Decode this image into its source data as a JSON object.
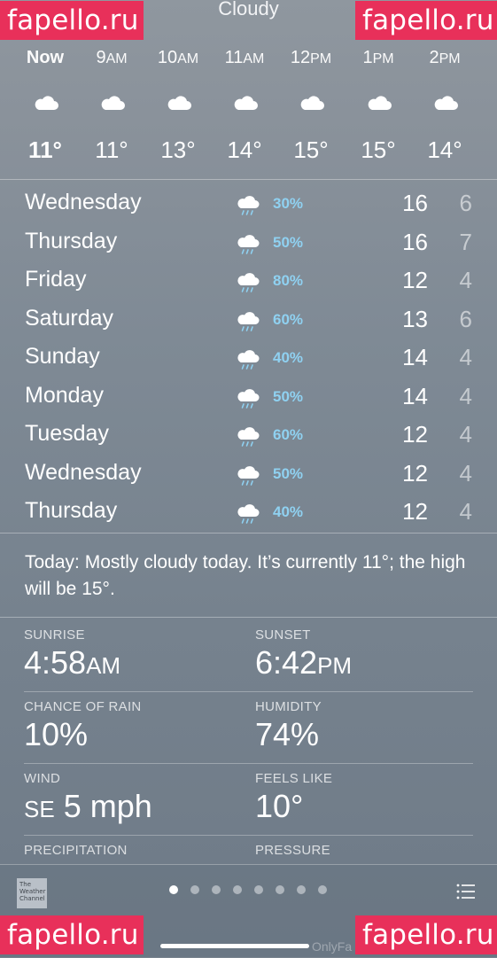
{
  "watermark": "fapello.ru",
  "header": {
    "condition": "Cloudy"
  },
  "hourly": [
    {
      "time": "Now",
      "suffix": "",
      "temp": "11°",
      "icon": "cloud-icon",
      "now": true
    },
    {
      "time": "9",
      "suffix": "AM",
      "temp": "11°",
      "icon": "cloud-icon"
    },
    {
      "time": "10",
      "suffix": "AM",
      "temp": "13°",
      "icon": "cloud-icon"
    },
    {
      "time": "11",
      "suffix": "AM",
      "temp": "14°",
      "icon": "cloud-icon"
    },
    {
      "time": "12",
      "suffix": "PM",
      "temp": "15°",
      "icon": "cloud-icon"
    },
    {
      "time": "1",
      "suffix": "PM",
      "temp": "15°",
      "icon": "cloud-icon"
    },
    {
      "time": "2",
      "suffix": "PM",
      "temp": "14°",
      "icon": "cloud-icon"
    }
  ],
  "daily": [
    {
      "day": "Wednesday",
      "chance": "30%",
      "high": "16",
      "low": "6",
      "icon": "rain-cloud-icon"
    },
    {
      "day": "Thursday",
      "chance": "50%",
      "high": "16",
      "low": "7",
      "icon": "rain-cloud-icon"
    },
    {
      "day": "Friday",
      "chance": "80%",
      "high": "12",
      "low": "4",
      "icon": "rain-cloud-icon"
    },
    {
      "day": "Saturday",
      "chance": "60%",
      "high": "13",
      "low": "6",
      "icon": "rain-cloud-icon"
    },
    {
      "day": "Sunday",
      "chance": "40%",
      "high": "14",
      "low": "4",
      "icon": "rain-cloud-icon"
    },
    {
      "day": "Monday",
      "chance": "50%",
      "high": "14",
      "low": "4",
      "icon": "rain-cloud-icon"
    },
    {
      "day": "Tuesday",
      "chance": "60%",
      "high": "12",
      "low": "4",
      "icon": "rain-cloud-icon"
    },
    {
      "day": "Wednesday",
      "chance": "50%",
      "high": "12",
      "low": "4",
      "icon": "rain-cloud-icon"
    },
    {
      "day": "Thursday",
      "chance": "40%",
      "high": "12",
      "low": "4",
      "icon": "rain-cloud-icon"
    }
  ],
  "summary": "Today: Mostly cloudy today. It’s currently 11°; the high will be 15°.",
  "details": {
    "sunrise": {
      "label": "SUNRISE",
      "value": "4:58",
      "suffix": "AM"
    },
    "sunset": {
      "label": "SUNSET",
      "value": "6:42",
      "suffix": "PM"
    },
    "chance_of_rain": {
      "label": "CHANCE OF RAIN",
      "value": "10%"
    },
    "humidity": {
      "label": "HUMIDITY",
      "value": "74%"
    },
    "wind": {
      "label": "WIND",
      "prefix": "SE",
      "value": "5 mph"
    },
    "feels_like": {
      "label": "FEELS LIKE",
      "value": "10°"
    },
    "precipitation": {
      "label": "PRECIPITATION"
    },
    "pressure": {
      "label": "PRESSURE"
    }
  },
  "footer": {
    "logo_text": "The Weather Channel",
    "page_count": 8,
    "active_page": 0,
    "credit": "OnlyFa"
  },
  "colors": {
    "chance_text": "#8fd1f1",
    "watermark_bg": "#e8305a"
  }
}
